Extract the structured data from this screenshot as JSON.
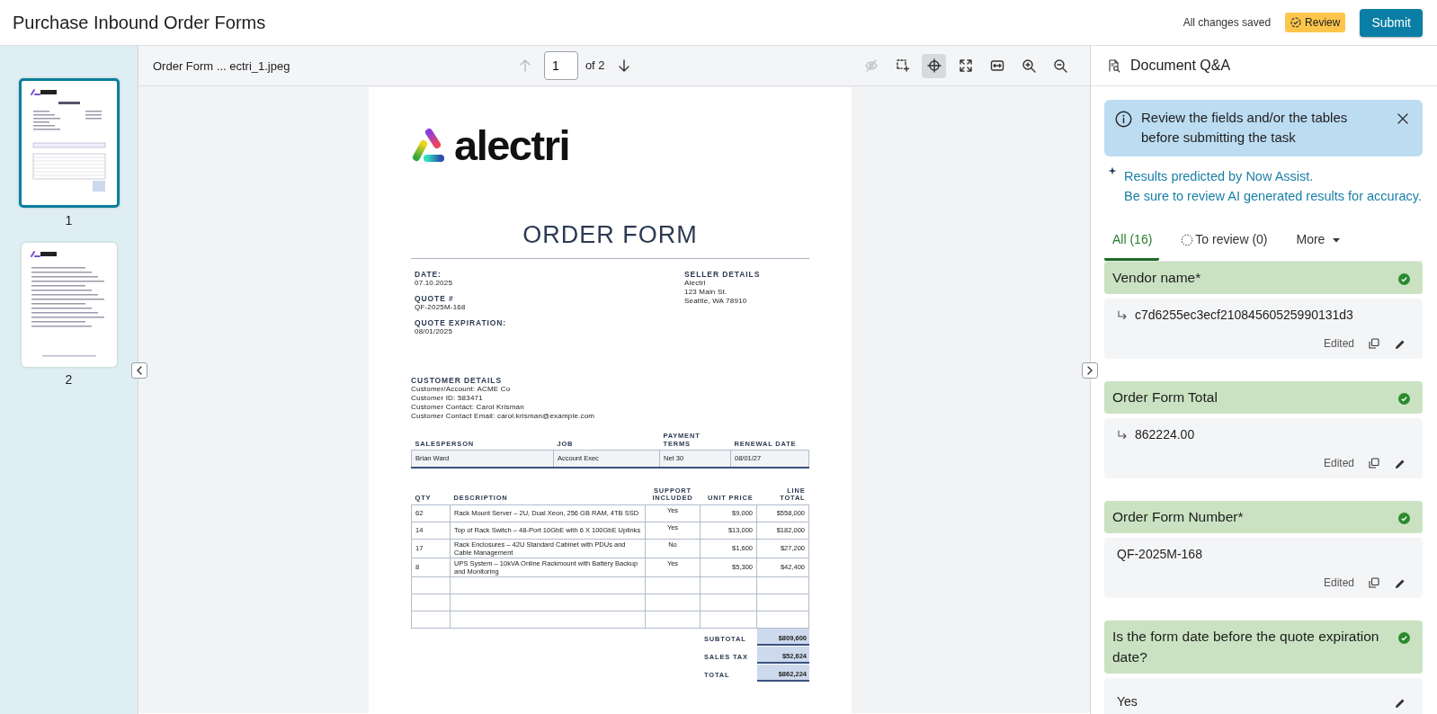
{
  "header": {
    "title": "Purchase Inbound Order Forms",
    "save_status": "All changes saved",
    "status_badge": "Review",
    "submit": "Submit"
  },
  "thumbnails": [
    {
      "label": "1",
      "selected": true
    },
    {
      "label": "2",
      "selected": false
    }
  ],
  "viewer": {
    "file_name": "Order Form ... ectri_1.jpeg",
    "prev_disabled": true,
    "next_disabled": false,
    "page_value": "1",
    "page_total": "of 2",
    "tools": [
      {
        "kind": "hide",
        "disabled": true,
        "selected": false
      },
      {
        "kind": "select",
        "disabled": false,
        "selected": false
      },
      {
        "kind": "target",
        "disabled": false,
        "selected": true
      },
      {
        "kind": "expand",
        "disabled": false,
        "selected": false
      },
      {
        "kind": "fit-width",
        "disabled": false,
        "selected": false
      },
      {
        "kind": "zoom-in",
        "disabled": false,
        "selected": false
      },
      {
        "kind": "zoom-out",
        "disabled": false,
        "selected": false
      }
    ]
  },
  "document": {
    "logo": "alectri",
    "title": "ORDER FORM",
    "info": [
      {
        "label": "DATE:",
        "value": "07.10.2025"
      },
      {
        "label": "QUOTE #",
        "value": "QF-2025M-168"
      },
      {
        "label": "QUOTE EXPIRATION:",
        "value": "08/01/2025"
      }
    ],
    "seller": {
      "label": "SELLER DETAILS",
      "lines": [
        "Alectri",
        "123 Main St.",
        "Seattle, WA 78910"
      ]
    },
    "customer": {
      "label": "CUSTOMER DETAILS",
      "lines": [
        "Customer/Account: ACME Co",
        "Customer ID: 583471",
        "Customer Contact: Carol Krisman",
        "Customer Contact Email: carol.krisman@example.com"
      ]
    },
    "sales_table": {
      "columns": [
        "SALESPERSON",
        "JOB",
        "PAYMENT TERMS",
        "RENEWAL DATE"
      ],
      "row": [
        "Brian Ward",
        "Account Exec",
        "Net 30",
        "08/01/27"
      ]
    },
    "items_table": {
      "columns": [
        "QTY",
        "DESCRIPTION",
        "SUPPORT INCLUDED",
        "UNIT PRICE",
        "LINE TOTAL"
      ],
      "rows": [
        [
          "62",
          "Rack Mount Server – 2U, Dual Xeon, 256 GB RAM, 4TB SSD",
          "Yes",
          "$9,000",
          "$558,000"
        ],
        [
          "14",
          "Top of Rack Switch – 48-Port 10GbE with 6 X 100GbE Uplinks",
          "Yes",
          "$13,000",
          "$182,000"
        ],
        [
          "17",
          "Rack Enclosures – 42U Standard Cabinet with PDUs and Cable Management",
          "No",
          "$1,600",
          "$27,200"
        ],
        [
          "8",
          "UPS System – 10kVA Online Rackmount with Battery Backup and Monitoring",
          "Yes",
          "$5,300",
          "$42,400"
        ]
      ]
    },
    "totals": [
      {
        "label": "SUBTOTAL",
        "value": "$809,600"
      },
      {
        "label": "SALES TAX",
        "value": "$52,624"
      },
      {
        "label": "TOTAL",
        "value": "$862,224"
      }
    ]
  },
  "qa": {
    "title": "Document Q&A",
    "alert": "Review the fields and/or the tables before submitting the task",
    "notice": [
      "Results predicted by Now Assist.",
      "Be sure to review AI generated results for accuracy."
    ],
    "tabs": [
      {
        "label": "All (16)",
        "kind": "plain",
        "selected": true
      },
      {
        "label": "To review (0)",
        "kind": "pending",
        "selected": false
      },
      {
        "label": "More",
        "kind": "menu",
        "selected": false
      }
    ],
    "fields": [
      {
        "label": "Vendor name*",
        "verified": true,
        "derived": true,
        "value": "c7d6255ec3ecf21084560525990131d3",
        "status": "Edited",
        "copyable": true
      },
      {
        "label": "Order Form Total",
        "verified": true,
        "derived": true,
        "value": "862224.00",
        "status": "Edited",
        "copyable": true
      },
      {
        "label": "Order Form Number*",
        "verified": true,
        "derived": false,
        "value": "QF-2025M-168",
        "status": "Edited",
        "copyable": true
      },
      {
        "label": "Is the form date before the quote expiration date?",
        "verified": true,
        "derived": false,
        "value": "Yes",
        "copyable": false
      }
    ]
  }
}
